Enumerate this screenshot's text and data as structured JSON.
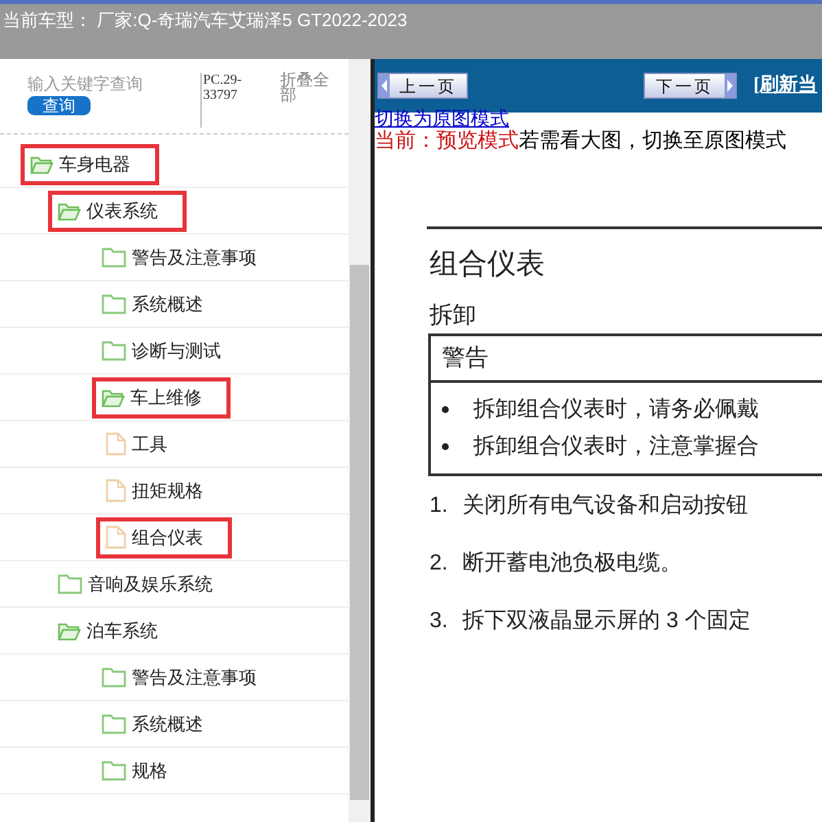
{
  "header": {
    "title": "当前车型：  厂家:Q-奇瑞汽车艾瑞泽5 GT2022-2023"
  },
  "search": {
    "placeholder": "输入关键字查询",
    "button": "查询",
    "code": "PC.29-33797",
    "collapse": "折叠全部"
  },
  "tree": [
    {
      "label": "车身电器",
      "kind": "folder",
      "expanded": true,
      "highlighted": true,
      "children": [
        {
          "label": "仪表系统",
          "kind": "folder",
          "expanded": true,
          "highlighted": true,
          "children": [
            {
              "label": "警告及注意事项",
              "kind": "folder",
              "expanded": false,
              "highlighted": false
            },
            {
              "label": "系统概述",
              "kind": "folder",
              "expanded": false,
              "highlighted": false
            },
            {
              "label": "诊断与测试",
              "kind": "folder",
              "expanded": false,
              "highlighted": false
            },
            {
              "label": "车上维修",
              "kind": "folder",
              "expanded": true,
              "highlighted": true,
              "children": [
                {
                  "label": "工具",
                  "kind": "file",
                  "expanded": false,
                  "highlighted": false
                },
                {
                  "label": "扭矩规格",
                  "kind": "file",
                  "expanded": false,
                  "highlighted": false
                },
                {
                  "label": "组合仪表",
                  "kind": "file",
                  "expanded": false,
                  "highlighted": true
                }
              ]
            }
          ]
        },
        {
          "label": "音响及娱乐系统",
          "kind": "folder",
          "expanded": false,
          "highlighted": false
        },
        {
          "label": "泊车系统",
          "kind": "folder",
          "expanded": true,
          "highlighted": false,
          "children": [
            {
              "label": "警告及注意事项",
              "kind": "folder",
              "expanded": false,
              "highlighted": false
            },
            {
              "label": "系统概述",
              "kind": "folder",
              "expanded": false,
              "highlighted": false
            },
            {
              "label": "规格",
              "kind": "folder",
              "expanded": false,
              "highlighted": false
            }
          ]
        }
      ]
    }
  ],
  "toolbar": {
    "prev": "上一页",
    "next": "下一页",
    "refresh": "[刷新当"
  },
  "mode": {
    "switch_link": "切换为原图模式",
    "current": "当前：预览模式",
    "hint": "若需看大图，切换至原图模式"
  },
  "document": {
    "title": "组合仪表",
    "section": "拆卸",
    "warning_title": "警告",
    "warnings": [
      "拆卸组合仪表时，请务必佩戴",
      "拆卸组合仪表时，注意掌握合"
    ],
    "steps": [
      {
        "number": "1.",
        "text": "关闭所有电气设备和启动按钮"
      },
      {
        "number": "2.",
        "text": "断开蓄电池负极电缆。"
      },
      {
        "number": "3.",
        "text": "拆下双液晶显示屏的 3 个固定"
      }
    ]
  }
}
